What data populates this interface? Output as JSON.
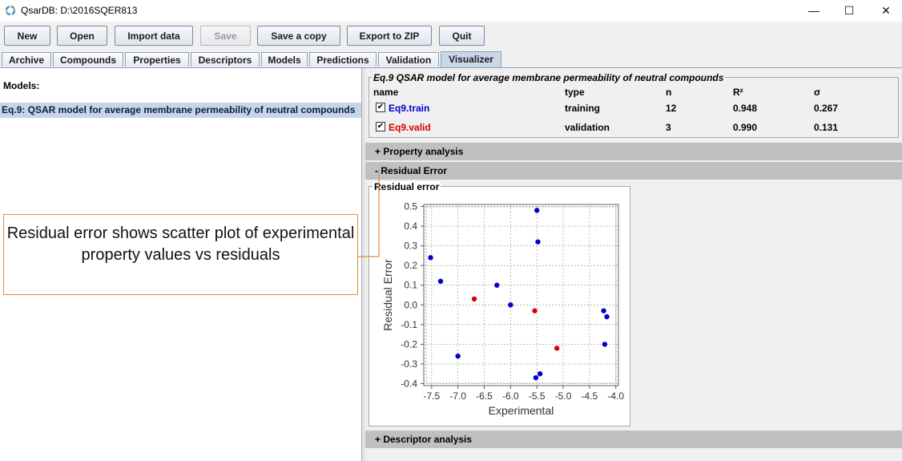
{
  "window": {
    "title": "QsarDB: D:\\2016SQER813",
    "minimize": "—",
    "maximize": "☐",
    "close": "✕"
  },
  "toolbar": [
    {
      "label": "New",
      "enabled": true
    },
    {
      "label": "Open",
      "enabled": true
    },
    {
      "label": "Import data",
      "enabled": true
    },
    {
      "label": "Save",
      "enabled": false
    },
    {
      "label": "Save a copy",
      "enabled": true
    },
    {
      "label": "Export to ZIP",
      "enabled": true
    },
    {
      "label": "Quit",
      "enabled": true
    }
  ],
  "tabs": [
    {
      "label": "Archive"
    },
    {
      "label": "Compounds"
    },
    {
      "label": "Properties"
    },
    {
      "label": "Descriptors"
    },
    {
      "label": "Models"
    },
    {
      "label": "Predictions"
    },
    {
      "label": "Validation"
    },
    {
      "label": "Visualizer",
      "active": true
    }
  ],
  "models_panel": {
    "header": "Models:",
    "selected_item": "Eq.9: QSAR model for average membrane permeability of neutral compounds"
  },
  "model_summary": {
    "title": "Eq.9 QSAR model for average membrane permeability of neutral compounds",
    "columns": [
      "name",
      "type",
      "n",
      "R²",
      "σ"
    ],
    "rows": [
      {
        "name": "Eq9.train",
        "type": "training",
        "n": "12",
        "r2": "0.948",
        "sigma": "0.267",
        "color": "#0000cc",
        "checked": true
      },
      {
        "name": "Eq9.valid",
        "type": "validation",
        "n": "3",
        "r2": "0.990",
        "sigma": "0.131",
        "color": "#dd0000",
        "checked": true
      }
    ]
  },
  "sections": {
    "property_analysis": "+ Property analysis",
    "residual_error": "- Residual Error",
    "descriptor_analysis": "+ Descriptor analysis"
  },
  "residual_panel": {
    "title": "Residual error"
  },
  "callout": {
    "text": "Residual error shows scatter plot of experimental property values vs residuals"
  },
  "chart_data": {
    "type": "scatter",
    "xlabel": "Experimental",
    "ylabel": "Residual Error",
    "xlim": [
      -7.65,
      -3.95
    ],
    "ylim": [
      -0.41,
      0.51
    ],
    "xticks": [
      "-7.5",
      "-7.0",
      "-6.5",
      "-6.0",
      "-5.5",
      "-5.0",
      "-4.5",
      "-4.0"
    ],
    "xtick_values": [
      -7.5,
      -7.0,
      -6.5,
      -6.0,
      -5.5,
      -5.0,
      -4.5,
      -4.0
    ],
    "yticks": [
      "0.5",
      "0.4",
      "0.3",
      "0.2",
      "0.1",
      "0.0",
      "-0.1",
      "-0.2",
      "-0.3",
      "-0.4"
    ],
    "ytick_values": [
      0.5,
      0.4,
      0.3,
      0.2,
      0.1,
      0.0,
      -0.1,
      -0.2,
      -0.3,
      -0.4
    ],
    "grid": true,
    "series": [
      {
        "color": "#0000cc",
        "points": [
          [
            -7.52,
            0.24
          ],
          [
            -7.33,
            0.12
          ],
          [
            -7.0,
            -0.26
          ],
          [
            -6.26,
            0.1
          ],
          [
            -6.0,
            0.0
          ],
          [
            -5.5,
            0.48
          ],
          [
            -5.48,
            0.32
          ],
          [
            -5.52,
            -0.37
          ],
          [
            -5.44,
            -0.35
          ],
          [
            -4.23,
            -0.03
          ],
          [
            -4.17,
            -0.06
          ],
          [
            -4.21,
            -0.2
          ]
        ]
      },
      {
        "color": "#dd0000",
        "points": [
          [
            -6.69,
            0.03
          ],
          [
            -5.54,
            -0.03
          ],
          [
            -5.12,
            -0.22
          ]
        ]
      }
    ]
  }
}
